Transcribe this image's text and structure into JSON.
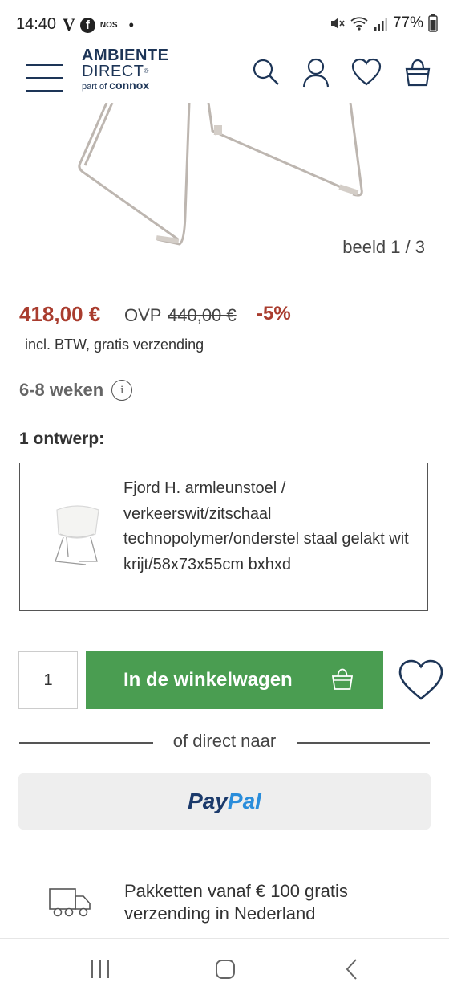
{
  "status_bar": {
    "time": "14:40",
    "left_icons": [
      "V",
      "facebook-icon",
      "NOS"
    ],
    "battery": "77%"
  },
  "header": {
    "logo_line1": "AMBIENTE",
    "logo_line2": "DIRECT",
    "logo_reg": "®",
    "logo_part": "part of",
    "logo_brand": "connox",
    "icons": [
      "menu-icon",
      "search-icon",
      "account-icon",
      "heart-icon",
      "cart-icon"
    ],
    "brand_color": "#1d3557"
  },
  "gallery": {
    "counter": "beeld 1 / 3"
  },
  "pricing": {
    "price": "418,00 €",
    "ovp_label": "OVP",
    "ovp_value": "440,00 €",
    "discount": "-5%",
    "vat_note": "incl. BTW, gratis verzending",
    "accent_color": "#a93c2e"
  },
  "delivery": {
    "time": "6-8 weken",
    "info_icon": "i"
  },
  "design": {
    "heading": "1 ontwerp:",
    "variant_text": "Fjord H. armleunstoel / verkeerswit/zitschaal technopolymer/onderstel staal gelakt wit krijt/58x73x55cm bxhxd"
  },
  "purchase": {
    "quantity": "1",
    "cart_label": "In de winkelwagen",
    "cart_color": "#4a9d51"
  },
  "alternatives": {
    "divider_text": "of direct naar",
    "paypal_part1": "Pay",
    "paypal_part2": "Pal"
  },
  "shipping": {
    "line1": "Pakketten vanaf € 100 gratis",
    "line2": "verzending in Nederland"
  },
  "nav": [
    "recent-apps-icon",
    "home-icon",
    "back-icon"
  ]
}
